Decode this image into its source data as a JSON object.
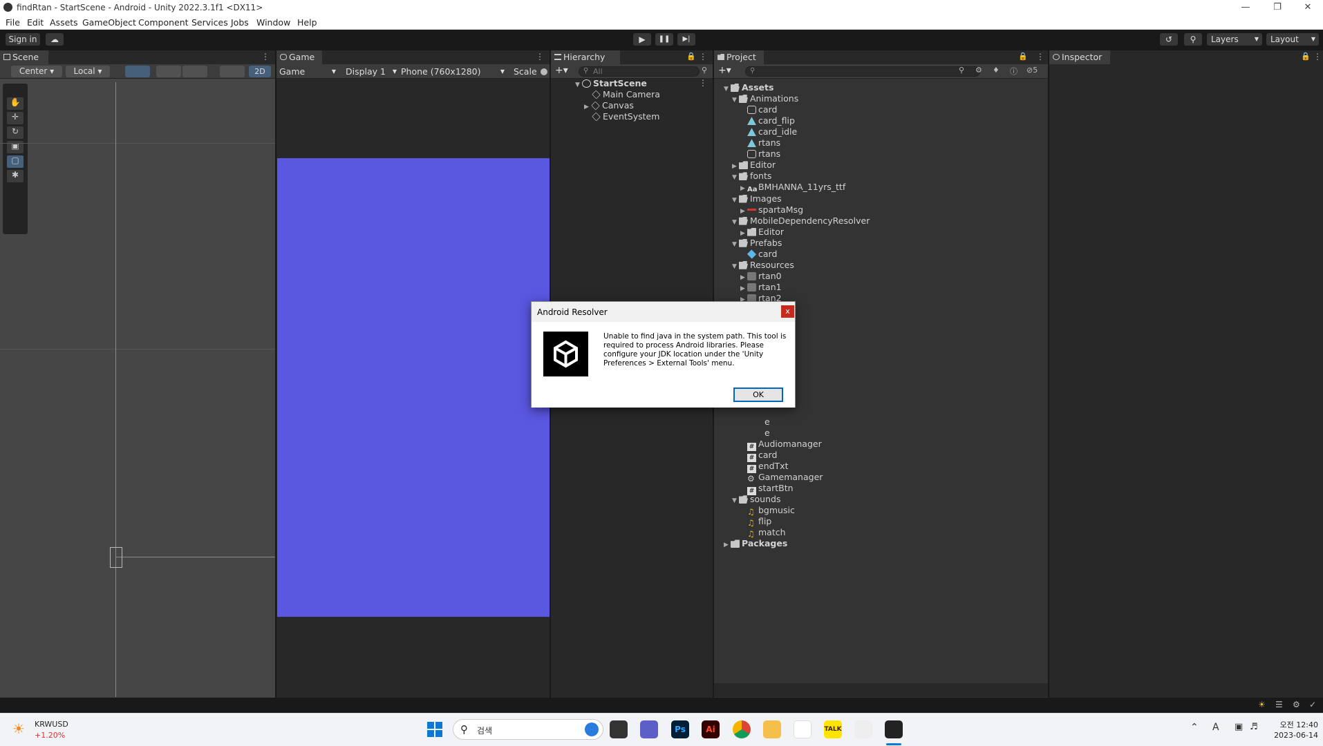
{
  "window": {
    "title": "findRtan - StartScene - Android - Unity 2022.3.1f1 <DX11>"
  },
  "menu": [
    "File",
    "Edit",
    "Assets",
    "GameObject",
    "Component",
    "Services",
    "Jobs",
    "Window",
    "Help"
  ],
  "toolbar": {
    "sign_in": "Sign in",
    "layers": "Layers",
    "layout": "Layout"
  },
  "scene": {
    "tab": "Scene",
    "pivot": "Center",
    "space": "Local",
    "mode_2d": "2D"
  },
  "game": {
    "tab": "Game",
    "view": "Game",
    "display": "Display 1",
    "resolution": "Phone (760x1280)",
    "scale_label": "Scale",
    "background_color": "#5a57e0"
  },
  "hierarchy": {
    "tab": "Hierarchy",
    "search_placeholder": "All",
    "scene_name": "StartScene",
    "items": [
      "Main Camera",
      "Canvas",
      "EventSystem"
    ]
  },
  "project": {
    "tab": "Project",
    "hidden_count": "5",
    "rows": [
      {
        "label": "Assets",
        "type": "folder-open",
        "depth": 0,
        "arrow": "down",
        "bold": true
      },
      {
        "label": "Animations",
        "type": "folder-open",
        "depth": 1,
        "arrow": "down"
      },
      {
        "label": "card",
        "type": "anim",
        "depth": 2
      },
      {
        "label": "card_flip",
        "type": "clip",
        "depth": 2
      },
      {
        "label": "card_idle",
        "type": "clip",
        "depth": 2
      },
      {
        "label": "rtans",
        "type": "clip",
        "depth": 2
      },
      {
        "label": "rtans",
        "type": "anim",
        "depth": 2
      },
      {
        "label": "Editor",
        "type": "folder",
        "depth": 1,
        "arrow": "right"
      },
      {
        "label": "fonts",
        "type": "folder-open",
        "depth": 1,
        "arrow": "down"
      },
      {
        "label": "BMHANNA_11yrs_ttf",
        "type": "font",
        "depth": 2,
        "arrow": "right"
      },
      {
        "label": "Images",
        "type": "folder-open",
        "depth": 1,
        "arrow": "down"
      },
      {
        "label": "spartaMsg",
        "type": "image",
        "depth": 2,
        "arrow": "right"
      },
      {
        "label": "MobileDependencyResolver",
        "type": "folder-open",
        "depth": 1,
        "arrow": "down"
      },
      {
        "label": "Editor",
        "type": "folder",
        "depth": 2,
        "arrow": "right"
      },
      {
        "label": "Prefabs",
        "type": "folder-open",
        "depth": 1,
        "arrow": "down"
      },
      {
        "label": "card",
        "type": "prefab",
        "depth": 2
      },
      {
        "label": "Resources",
        "type": "folder-open",
        "depth": 1,
        "arrow": "down"
      },
      {
        "label": "rtan0",
        "type": "sprite",
        "depth": 2,
        "arrow": "right"
      },
      {
        "label": "rtan1",
        "type": "sprite",
        "depth": 2,
        "arrow": "right"
      },
      {
        "label": "rtan2",
        "type": "sprite",
        "depth": 2,
        "arrow": "right"
      }
    ],
    "partial_rows": [
      "e",
      "e"
    ],
    "rows_after": [
      {
        "label": "Audiomanager",
        "type": "script",
        "depth": 2
      },
      {
        "label": "card",
        "type": "script",
        "depth": 2
      },
      {
        "label": "endTxt",
        "type": "script",
        "depth": 2
      },
      {
        "label": "Gamemanager",
        "type": "gear",
        "depth": 2
      },
      {
        "label": "startBtn",
        "type": "script",
        "depth": 2
      },
      {
        "label": "sounds",
        "type": "folder-open",
        "depth": 1,
        "arrow": "down"
      },
      {
        "label": "bgmusic",
        "type": "audio",
        "depth": 2
      },
      {
        "label": "flip",
        "type": "audio",
        "depth": 2
      },
      {
        "label": "match",
        "type": "audio",
        "depth": 2
      },
      {
        "label": "Packages",
        "type": "folder",
        "depth": 0,
        "arrow": "right",
        "bold": true
      }
    ]
  },
  "inspector": {
    "tab": "Inspector"
  },
  "dialog": {
    "title": "Android Resolver",
    "close": "x",
    "message": "Unable to find java in the system path.  This tool is required to process Android libraries.  Please configure your JDK location under the 'Unity Preferences > External Tools' menu.",
    "ok": "OK"
  },
  "taskbar": {
    "ticker": "KRWUSD",
    "ticker_change": "+1.20%",
    "search_placeholder": "검색",
    "time": "오전 12:40",
    "date": "2023-06-14"
  }
}
